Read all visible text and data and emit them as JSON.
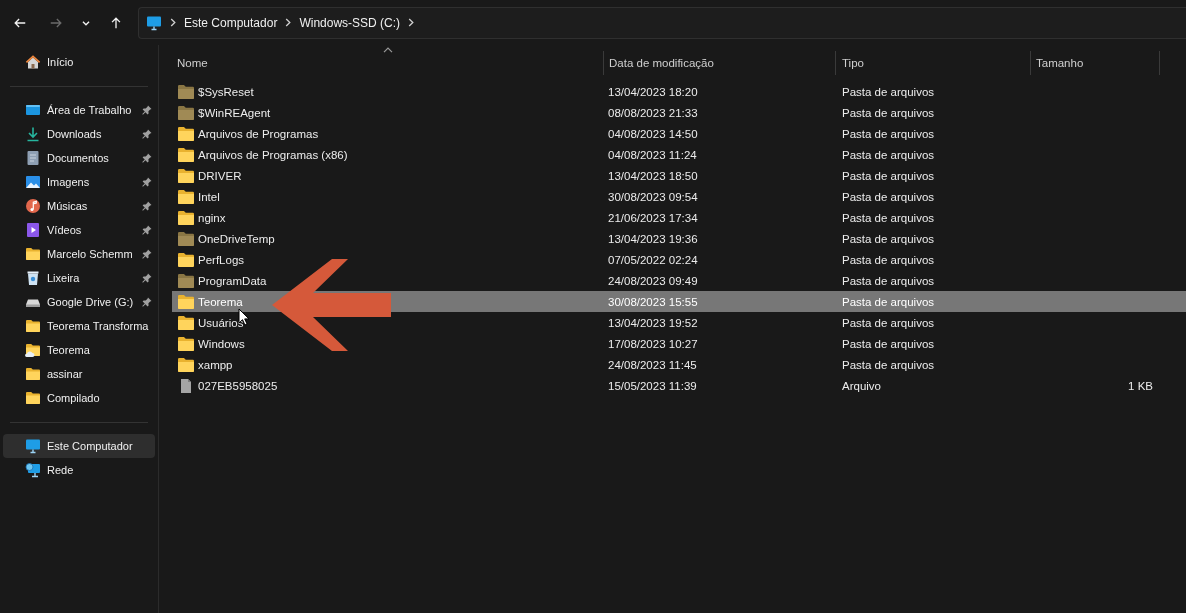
{
  "nav": {
    "buttons": [
      {
        "kind": "back",
        "disabled": false
      },
      {
        "kind": "forward",
        "disabled": true
      },
      {
        "kind": "recent",
        "disabled": false
      },
      {
        "kind": "up",
        "disabled": false
      }
    ]
  },
  "address_bar": {
    "crumbs": [
      "Este Computador",
      "Windows-SSD (C:)"
    ]
  },
  "sidebar": {
    "groups": [
      {
        "items": [
          {
            "label": "Início",
            "kind": "home",
            "pinned": false,
            "selected": false
          }
        ]
      },
      {
        "items": [
          {
            "label": "Área de Trabalho",
            "kind": "desktop",
            "pinned": true,
            "selected": false
          },
          {
            "label": "Downloads",
            "kind": "downloads",
            "pinned": true,
            "selected": false
          },
          {
            "label": "Documentos",
            "kind": "documents",
            "pinned": true,
            "selected": false
          },
          {
            "label": "Imagens",
            "kind": "pictures",
            "pinned": true,
            "selected": false
          },
          {
            "label": "Músicas",
            "kind": "music",
            "pinned": true,
            "selected": false
          },
          {
            "label": "Vídeos",
            "kind": "videos",
            "pinned": true,
            "selected": false
          },
          {
            "label": "Marcelo Schemm",
            "kind": "folder",
            "pinned": true,
            "selected": false
          },
          {
            "label": "Lixeira",
            "kind": "recycle",
            "pinned": true,
            "selected": false
          },
          {
            "label": "Google Drive (G:)",
            "kind": "drive",
            "pinned": true,
            "selected": false
          },
          {
            "label": "Teorema Transforma",
            "kind": "folder",
            "pinned": false,
            "selected": false
          },
          {
            "label": "Teorema",
            "kind": "folder-cloud",
            "pinned": false,
            "selected": false
          },
          {
            "label": "assinar",
            "kind": "folder",
            "pinned": false,
            "selected": false
          },
          {
            "label": "Compilado",
            "kind": "folder",
            "pinned": false,
            "selected": false
          }
        ]
      },
      {
        "items": [
          {
            "label": "Este Computador",
            "kind": "pc",
            "pinned": false,
            "selected": true
          },
          {
            "label": "Rede",
            "kind": "network",
            "pinned": false,
            "selected": false
          }
        ]
      }
    ]
  },
  "file_list": {
    "columns": [
      {
        "label": "Nome",
        "sorted": true
      },
      {
        "label": "Data de modificação",
        "sorted": false
      },
      {
        "label": "Tipo",
        "sorted": false
      },
      {
        "label": "Tamanho",
        "sorted": false
      }
    ],
    "rows": [
      {
        "name": "$SysReset",
        "modified": "13/04/2023 18:20",
        "type": "Pasta de arquivos",
        "kind": "folder",
        "hidden": true,
        "selected": false
      },
      {
        "name": "$WinREAgent",
        "modified": "08/08/2023 21:33",
        "type": "Pasta de arquivos",
        "kind": "folder",
        "hidden": true,
        "selected": false
      },
      {
        "name": "Arquivos de Programas",
        "modified": "04/08/2023 14:50",
        "type": "Pasta de arquivos",
        "kind": "folder",
        "hidden": false,
        "selected": false
      },
      {
        "name": "Arquivos de Programas (x86)",
        "modified": "04/08/2023 11:24",
        "type": "Pasta de arquivos",
        "kind": "folder",
        "hidden": false,
        "selected": false
      },
      {
        "name": "DRIVER",
        "modified": "13/04/2023 18:50",
        "type": "Pasta de arquivos",
        "kind": "folder",
        "hidden": false,
        "selected": false
      },
      {
        "name": "Intel",
        "modified": "30/08/2023 09:54",
        "type": "Pasta de arquivos",
        "kind": "folder",
        "hidden": false,
        "selected": false
      },
      {
        "name": "nginx",
        "modified": "21/06/2023 17:34",
        "type": "Pasta de arquivos",
        "kind": "folder",
        "hidden": false,
        "selected": false
      },
      {
        "name": "OneDriveTemp",
        "modified": "13/04/2023 19:36",
        "type": "Pasta de arquivos",
        "kind": "folder",
        "hidden": true,
        "selected": false
      },
      {
        "name": "PerfLogs",
        "modified": "07/05/2022 02:24",
        "type": "Pasta de arquivos",
        "kind": "folder",
        "hidden": false,
        "selected": false
      },
      {
        "name": "ProgramData",
        "modified": "24/08/2023 09:49",
        "type": "Pasta de arquivos",
        "kind": "folder",
        "hidden": true,
        "selected": false
      },
      {
        "name": "Teorema",
        "modified": "30/08/2023 15:55",
        "type": "Pasta de arquivos",
        "kind": "folder",
        "hidden": false,
        "selected": true
      },
      {
        "name": "Usuários",
        "modified": "13/04/2023 19:52",
        "type": "Pasta de arquivos",
        "kind": "folder",
        "hidden": false,
        "selected": false
      },
      {
        "name": "Windows",
        "modified": "17/08/2023 10:27",
        "type": "Pasta de arquivos",
        "kind": "folder",
        "hidden": false,
        "selected": false
      },
      {
        "name": "xampp",
        "modified": "24/08/2023 11:45",
        "type": "Pasta de arquivos",
        "kind": "folder",
        "hidden": false,
        "selected": false
      },
      {
        "name": "027EB5958025",
        "modified": "15/05/2023 11:39",
        "type": "Arquivo",
        "size": "1 KB",
        "kind": "file",
        "hidden": false,
        "selected": false
      }
    ]
  }
}
